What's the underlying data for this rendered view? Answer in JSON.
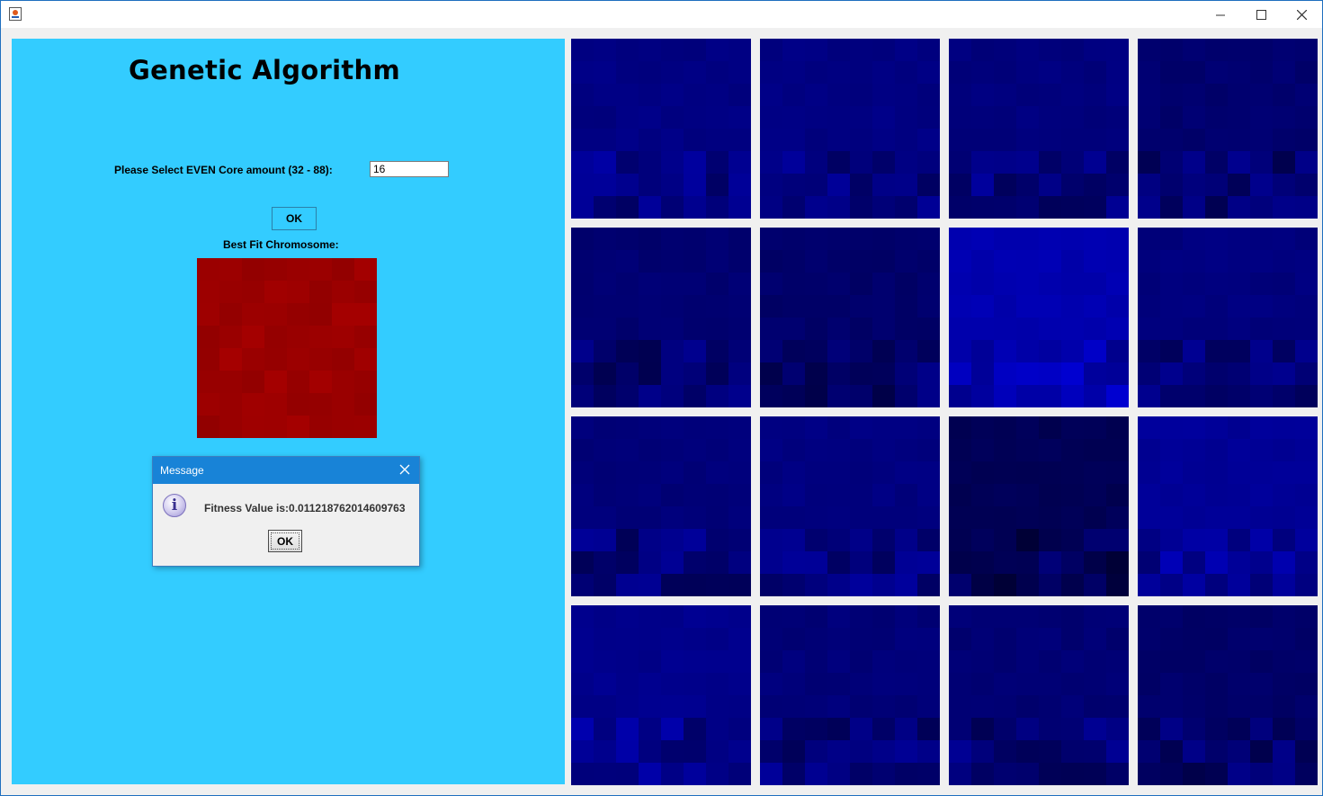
{
  "window": {
    "icon": "java-app-icon",
    "controls": [
      "minimize-icon",
      "maximize-icon",
      "close-icon"
    ]
  },
  "left_panel": {
    "title": "Genetic Algorithm",
    "core_label": "Please Select EVEN Core amount (32 - 88):",
    "core_input_value": "16",
    "ok_label": "OK",
    "best_fit_label": "Best Fit Chromosome:"
  },
  "dialog": {
    "title": "Message",
    "icon": "info-icon",
    "message": "Fitness Value is:0.011218762014609763",
    "ok_label": "OK"
  },
  "colors": {
    "panel_background": "#33ccff",
    "best_fit": "#9a0000",
    "tiles": "#000099",
    "dialog_titlebar": "#1883d7"
  }
}
